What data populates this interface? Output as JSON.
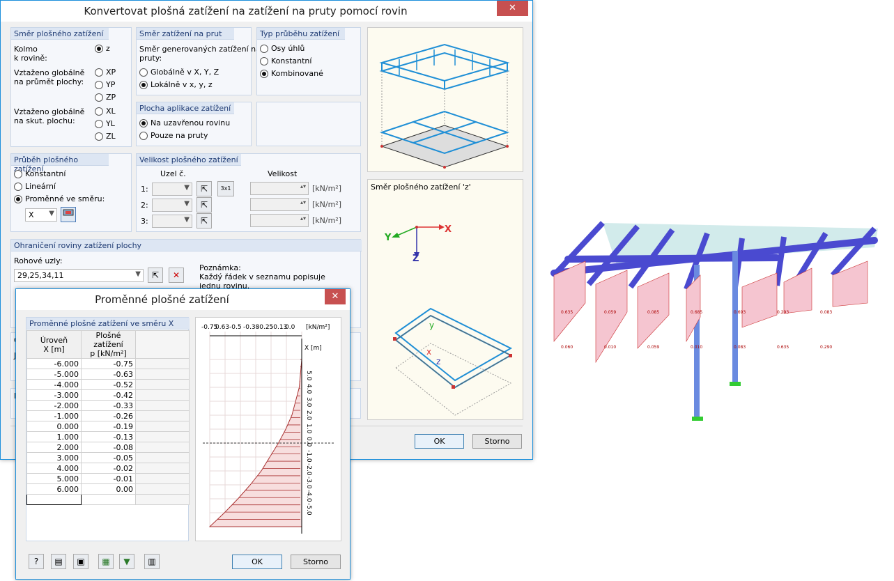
{
  "main": {
    "title": "Konvertovat plošná zatížení na zatížení na pruty pomocí rovin",
    "close": "✕",
    "dir_group": {
      "title": "Směr plošného zatížení",
      "perp": "Kolmo k rovině:",
      "perp1": "Kolmo",
      "perp2": "k rovině:",
      "z": "z",
      "proj1": "Vztaženo globálně",
      "proj2": "na průmět plochy:",
      "xp": "XP",
      "yp": "YP",
      "zp": "ZP",
      "true1": "Vztaženo globálně",
      "true2": "na skut. plochu:",
      "xl": "XL",
      "yl": "YL",
      "zl": "ZL"
    },
    "member_dir": {
      "title": "Směr zatížení na prut",
      "desc1": "Směr generovaných zatížení na",
      "desc2": "pruty:",
      "global": "Globálně v X, Y, Z",
      "local": "Lokálně v x, y, z"
    },
    "dist_type": {
      "title": "Typ průběhu zatížení",
      "opt1": "Osy úhlů",
      "opt2": "Konstantní",
      "opt3": "Kombinované"
    },
    "apply": {
      "title": "Plocha aplikace zatížení",
      "opt1": "Na uzavřenou rovinu",
      "opt2": "Pouze na pruty"
    },
    "dist": {
      "title": "Průběh plošného zatížení",
      "opt1": "Konstantní",
      "opt2": "Lineární",
      "opt3": "Proměnné ve směru:",
      "axis": "X"
    },
    "magnitude": {
      "title": "Velikost plošného zatížení",
      "node_col": "Uzel č.",
      "size_col": "Velikost",
      "r1": "1:",
      "r2": "2:",
      "r3": "3:",
      "unit": "[kN/m²]",
      "icon3": "3x1"
    },
    "boundary": {
      "title": "Ohraničení roviny zatížení plochy",
      "corner_label": "Rohové uzly:",
      "corner_value": "29,25,34,11",
      "note_title": "Poznámka:",
      "note1": "Každý řádek v seznamu popisuje",
      "note2": "jednu rovinu."
    },
    "hidden_a": "O",
    "hidden_b": "J",
    "hidden_c": "K",
    "ok": "OK",
    "cancel": "Storno",
    "preview_caption": "Směr plošného zatížení 'z'",
    "axes": {
      "x": "X",
      "y": "Y",
      "z": "Z",
      "y_local": "y",
      "x_local": "x",
      "z_local": "z"
    }
  },
  "sub": {
    "title": "Proměnné plošné zatížení",
    "close": "✕",
    "table_title": "Proměnné plošné zatížení ve směru X",
    "col1a": "Úroveň",
    "col1b": "X [m]",
    "col2a": "Plošné zatížení",
    "col2b": "p [kN/m²]",
    "rows": [
      [
        "-6.000",
        "-0.75"
      ],
      [
        "-5.000",
        "-0.63"
      ],
      [
        "-4.000",
        "-0.52"
      ],
      [
        "-3.000",
        "-0.42"
      ],
      [
        "-2.000",
        "-0.33"
      ],
      [
        "-1.000",
        "-0.26"
      ],
      [
        "0.000",
        "-0.19"
      ],
      [
        "1.000",
        "-0.13"
      ],
      [
        "2.000",
        "-0.08"
      ],
      [
        "3.000",
        "-0.05"
      ],
      [
        "4.000",
        "-0.02"
      ],
      [
        "5.000",
        "-0.01"
      ],
      [
        "6.000",
        "0.00"
      ]
    ],
    "top_ticks": [
      "-0.75",
      "0.63",
      "-0.5",
      "-0.38",
      "-0.25",
      "-0.13",
      "0.0"
    ],
    "top_unit": "[kN/m²]",
    "axis_label": "X [m]",
    "side_ticks": [
      "5.0",
      "4.0",
      "3.0",
      "2.0",
      "1.0",
      "0.0",
      "-1.0",
      "-2.0",
      "-3.0",
      "-4.0",
      "-5.0"
    ],
    "ok": "OK",
    "cancel": "Storno"
  },
  "model_labels": [
    "0.635",
    "0.059",
    "0.085",
    "0.685",
    "0.693",
    "0.293",
    "0.083",
    "0.060",
    "0.010",
    "0.059",
    "0.010",
    "0.083",
    "0.635",
    "0.290"
  ]
}
